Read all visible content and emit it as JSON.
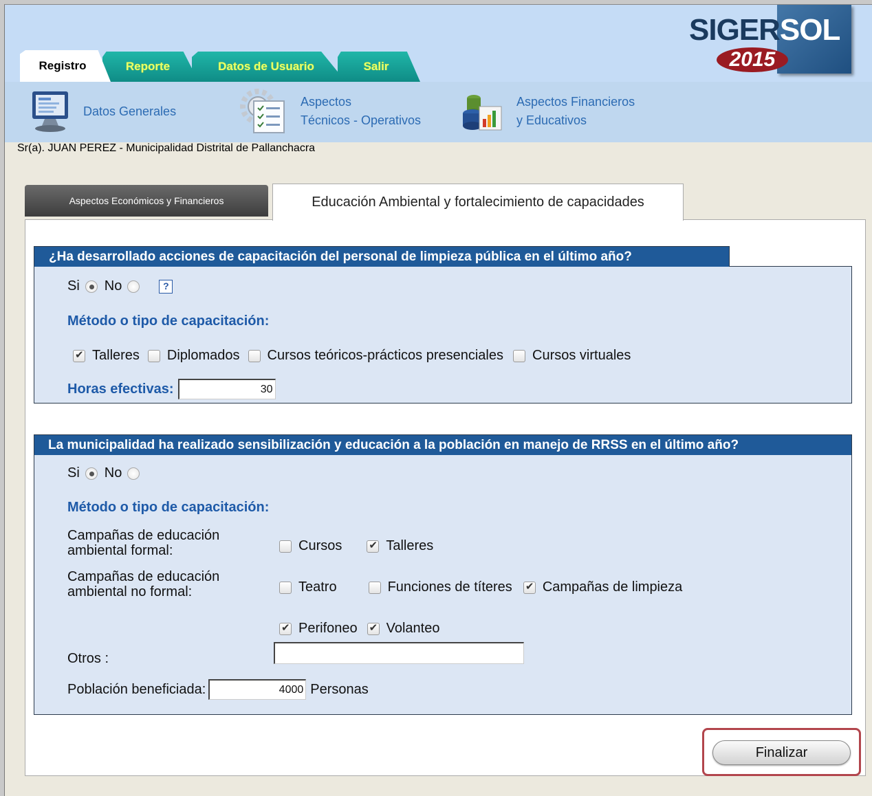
{
  "logo": {
    "text_dark": "SIGER",
    "text_light": "SOL",
    "year": "2015"
  },
  "nav_tabs": [
    {
      "label": "Registro",
      "active": true
    },
    {
      "label": "Reporte",
      "active": false
    },
    {
      "label": "Datos de Usuario",
      "active": false
    },
    {
      "label": "Salir",
      "active": false
    }
  ],
  "icon_links": {
    "datos_generales": "Datos Generales",
    "aspectos_tecnicos_1": "Aspectos",
    "aspectos_tecnicos_2": "Técnicos - Operativos",
    "aspectos_financieros_1": "Aspectos Financieros",
    "aspectos_financieros_2": "y Educativos"
  },
  "user_line": "Sr(a). JUAN PEREZ - Municipalidad Distrital de Pallanchacra",
  "sub_tabs": {
    "economicos": "Aspectos Económicos y Financieros",
    "educacion": "Educación Ambiental y fortalecimiento de capacidades"
  },
  "section1": {
    "title": "¿Ha desarrollado acciones de capacitación del personal de limpieza pública en el último año?",
    "si_label": "Si",
    "no_label": "No",
    "selected": "Si",
    "help": "?",
    "metodo_label": "Método o tipo de capacitación:",
    "options": [
      {
        "label": "Talleres",
        "checked": true
      },
      {
        "label": "Diplomados",
        "checked": false
      },
      {
        "label": "Cursos teóricos-prácticos presenciales",
        "checked": false
      },
      {
        "label": "Cursos virtuales",
        "checked": false
      }
    ],
    "horas_label": "Horas efectivas:",
    "horas_value": "30"
  },
  "section2": {
    "title": "La municipalidad ha realizado sensibilización y educación a la población en manejo de RRSS en el último año?",
    "si_label": "Si",
    "no_label": "No",
    "selected": "Si",
    "metodo_label": "Método o tipo de capacitación:",
    "formal_label_1": "Campañas de educación",
    "formal_label_2": "ambiental formal:",
    "formal_options": [
      {
        "label": "Cursos",
        "checked": false
      },
      {
        "label": "Talleres",
        "checked": true
      }
    ],
    "noformal_label_1": "Campañas de educación",
    "noformal_label_2": "ambiental no formal:",
    "noformal_options": [
      {
        "label": "Teatro",
        "checked": false
      },
      {
        "label": "Funciones de títeres",
        "checked": false
      },
      {
        "label": "Campañas de limpieza",
        "checked": true
      },
      {
        "label": "Perifoneo",
        "checked": true
      },
      {
        "label": "Volanteo",
        "checked": true
      }
    ],
    "otros_label": "Otros :",
    "otros_value": "",
    "poblacion_label": "Población beneficiada:",
    "poblacion_value": "4000",
    "poblacion_unit": "Personas"
  },
  "finalizar_label": "Finalizar"
}
